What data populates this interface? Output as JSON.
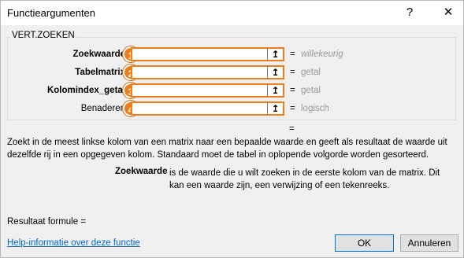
{
  "window": {
    "title": "Functieargumenten",
    "help_label": "?",
    "close_label": "✕"
  },
  "function_group": {
    "name": "VERT.ZOEKEN"
  },
  "arguments": [
    {
      "label": "Zoekwaarde",
      "badge": "1",
      "value": "",
      "result": "willekeurig",
      "bold": true,
      "italic_result": true
    },
    {
      "label": "Tabelmatrix",
      "badge": "2",
      "value": "",
      "result": "getal",
      "bold": true,
      "italic_result": false
    },
    {
      "label": "Kolomindex_getal",
      "badge": "3",
      "value": "",
      "result": "getal",
      "bold": true,
      "italic_result": false
    },
    {
      "label": "Benaderen",
      "badge": "4",
      "value": "",
      "result": "logisch",
      "bold": false,
      "italic_result": false
    }
  ],
  "equals_sign": "=",
  "ref_icon": "upload-icon",
  "description": "Zoekt in de meest linkse kolom van een matrix naar een bepaalde waarde en geeft als resultaat de waarde uit dezelfde rij in een opgegeven kolom. Standaard moet de tabel in oplopende volgorde worden gesorteerd.",
  "arg_help": {
    "name": "Zoekwaarde",
    "text": "is de waarde die u wilt zoeken in de eerste kolom van de matrix. Dit kan een waarde zijn, een verwijzing of een tekenreeks."
  },
  "formula_result_label": "Resultaat formule =",
  "help_link": "Help-informatie over deze functie",
  "buttons": {
    "ok": "OK",
    "cancel": "Annuleren"
  },
  "colors": {
    "accent": "#ef7d1c",
    "link": "#0066cc"
  }
}
